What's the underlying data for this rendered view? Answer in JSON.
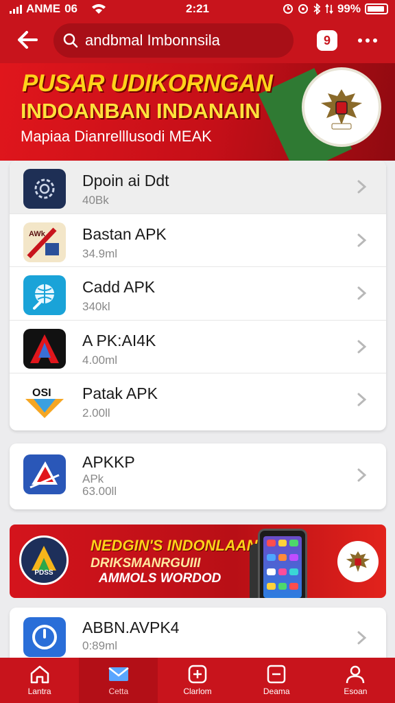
{
  "status_bar": {
    "carrier": "ANME",
    "network": "06",
    "time": "2:21",
    "battery": "99%"
  },
  "header": {
    "search_text": "andbmal Imbonnsila",
    "badge_count": "9",
    "back_icon": "back-arrow-icon",
    "more_icon": "more-dots-icon"
  },
  "hero_banner": {
    "title": "PUSAR UDIKORNGAN",
    "subtitle": "INDOANBAN INDANAIN",
    "tagline": "Mapiaa Dianrelllusodi MEAK"
  },
  "app_list_1": [
    {
      "name": "Dpoin ai Ddt",
      "size": "40Bk",
      "icon": "gear-shield-icon",
      "color": "#1e2f55"
    },
    {
      "name": "Bastan APK",
      "size": "34.9ml",
      "icon": "banner-flag-icon",
      "color": "#f3e6c8"
    },
    {
      "name": "Cadd APK",
      "size": "340kl",
      "icon": "globe-icon",
      "color": "#1aa3d8"
    },
    {
      "name": "A PK:AI4K",
      "size": "4.00ml",
      "icon": "triangle-a-icon",
      "color": "#111111"
    },
    {
      "name": "Patak APK",
      "size": "2.00ll",
      "icon": "osi-logo-icon",
      "color": "#ffffff"
    }
  ],
  "app_card_2": {
    "name": "APKKP",
    "subtitle": "APk",
    "size": "63.00ll",
    "icon": "paper-plane-icon",
    "color": "#2a57b8"
  },
  "promo_banner": {
    "logo_text": "PDSS",
    "line1": "NEDGIN'S INDONLAAN",
    "line2": "DRIKSMANRGUIII",
    "line3": "AMMOLS WORDOD"
  },
  "app_card_3": {
    "name": "ABBN.AVPK4",
    "size": "0:89ml",
    "icon": "clock-badge-icon",
    "color": "#2a6ed8"
  },
  "bottom_nav": [
    {
      "label": "Lantra",
      "icon": "home-icon",
      "active": false
    },
    {
      "label": "Cetta",
      "icon": "mail-icon",
      "active": true
    },
    {
      "label": "Clarlom",
      "icon": "plus-box-icon",
      "active": false
    },
    {
      "label": "Deama",
      "icon": "minus-box-icon",
      "active": false
    },
    {
      "label": "Esoan",
      "icon": "user-icon",
      "active": false
    }
  ],
  "colors": {
    "primary_red": "#c8141c",
    "accent_yellow": "#ffd21a"
  }
}
